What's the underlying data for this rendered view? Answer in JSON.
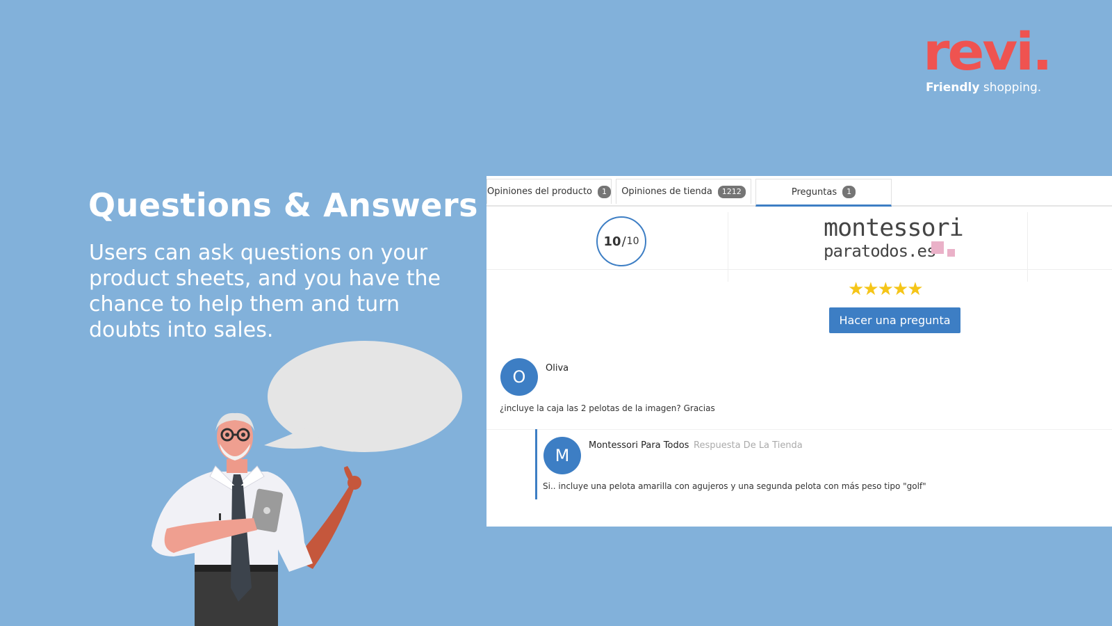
{
  "brand": {
    "logo_word": "revi.",
    "tag_strong": "Friendly",
    "tag_rest": " shopping.",
    "accent_color": "#ef5350",
    "background_color": "#82b1da"
  },
  "hero": {
    "title": "Questions & Answers",
    "description": "Users can ask questions on your product sheets, and you have the chance to help them and turn doubts into sales."
  },
  "widget": {
    "tabs": [
      {
        "label": "Opiniones del producto",
        "count": "1",
        "active": false
      },
      {
        "label": "Opiniones de tienda",
        "count": "1212",
        "active": false
      },
      {
        "label": "Preguntas",
        "count": "1",
        "active": true
      }
    ],
    "score": {
      "value": "10",
      "separator": "/",
      "max": "10"
    },
    "store": {
      "name_line1": "montessori",
      "name_line2": "paratodos.es",
      "rating_stars": 5,
      "stars_glyphs": "★★★★★"
    },
    "ask_button_label": "Hacer una pregunta",
    "question": {
      "avatar_letter": "O",
      "author": "Oliva",
      "text": "¿incluye la caja las 2 pelotas de la imagen? Gracias"
    },
    "answer": {
      "avatar_letter": "M",
      "author": "Montessori Para Todos",
      "role": "Respuesta De La Tienda",
      "text": "Si.. incluye una pelota amarilla con agujeros y una segunda pelota con más peso tipo \"golf\""
    },
    "primary_color": "#3d7ec4",
    "star_color": "#f5c518"
  }
}
